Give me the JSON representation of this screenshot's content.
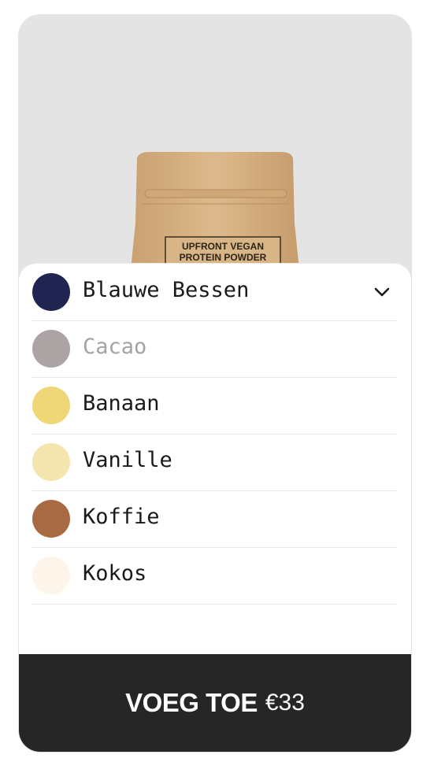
{
  "product": {
    "label_line1": "UPFRONT VEGAN",
    "label_line2": "PROTEIN POWDER"
  },
  "flavors": {
    "selected": "Blauwe Bessen",
    "chevron_icon": "chevron-down-icon",
    "options": [
      {
        "label": "Blauwe Bessen",
        "color": "#1f2550",
        "disabled": false
      },
      {
        "label": "Cacao",
        "color": "#aba3a4",
        "disabled": true
      },
      {
        "label": "Banaan",
        "color": "#efd777",
        "disabled": false
      },
      {
        "label": "Vanille",
        "color": "#f4e5ae",
        "disabled": false
      },
      {
        "label": "Koffie",
        "color": "#a86a43",
        "disabled": false
      },
      {
        "label": "Kokos",
        "color": "#fdf5ea",
        "disabled": false
      }
    ]
  },
  "cta": {
    "label": "VOEG TOE",
    "price": "€33",
    "background": "#262626"
  }
}
